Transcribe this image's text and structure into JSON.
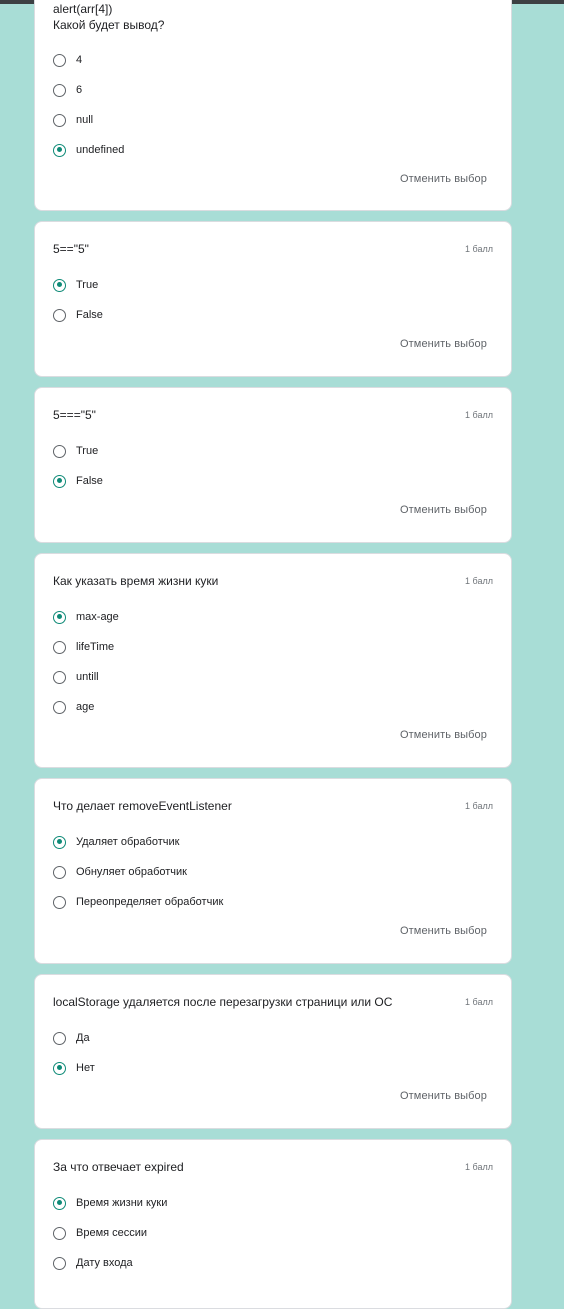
{
  "colors": {
    "background": "#a8ddd6",
    "accent": "#0e8a77"
  },
  "clear_label": "Отменить выбор",
  "questions": [
    {
      "title": "alert(arr[4])\nКакой будет вывод?",
      "points": "",
      "options": [
        {
          "label": "4",
          "selected": false
        },
        {
          "label": "6",
          "selected": false
        },
        {
          "label": "null",
          "selected": false
        },
        {
          "label": "undefined",
          "selected": true
        }
      ]
    },
    {
      "title": "5==\"5\"",
      "points": "1 балл",
      "options": [
        {
          "label": "True",
          "selected": true
        },
        {
          "label": "False",
          "selected": false
        }
      ]
    },
    {
      "title": "5===\"5\"",
      "points": "1 балл",
      "options": [
        {
          "label": "True",
          "selected": false
        },
        {
          "label": "False",
          "selected": true
        }
      ]
    },
    {
      "title": "Как указать время жизни куки",
      "points": "1 балл",
      "options": [
        {
          "label": "max-age",
          "selected": true
        },
        {
          "label": "lifeTime",
          "selected": false
        },
        {
          "label": "untill",
          "selected": false
        },
        {
          "label": "age",
          "selected": false
        }
      ]
    },
    {
      "title": "Что делает removeEventListener",
      "points": "1 балл",
      "options": [
        {
          "label": "Удаляет обработчик",
          "selected": true
        },
        {
          "label": "Обнуляет обработчик",
          "selected": false
        },
        {
          "label": "Переопределяет обработчик",
          "selected": false
        }
      ]
    },
    {
      "title": "localStorage удаляется после перезагрузки страници или ОС",
      "points": "1 балл",
      "options": [
        {
          "label": "Да",
          "selected": false
        },
        {
          "label": "Нет",
          "selected": true
        }
      ]
    },
    {
      "title": "За что отвечает expired",
      "points": "1 балл",
      "options": [
        {
          "label": "Время жизни куки",
          "selected": true
        },
        {
          "label": "Время сессии",
          "selected": false
        },
        {
          "label": "Дату входа",
          "selected": false
        }
      ]
    }
  ]
}
